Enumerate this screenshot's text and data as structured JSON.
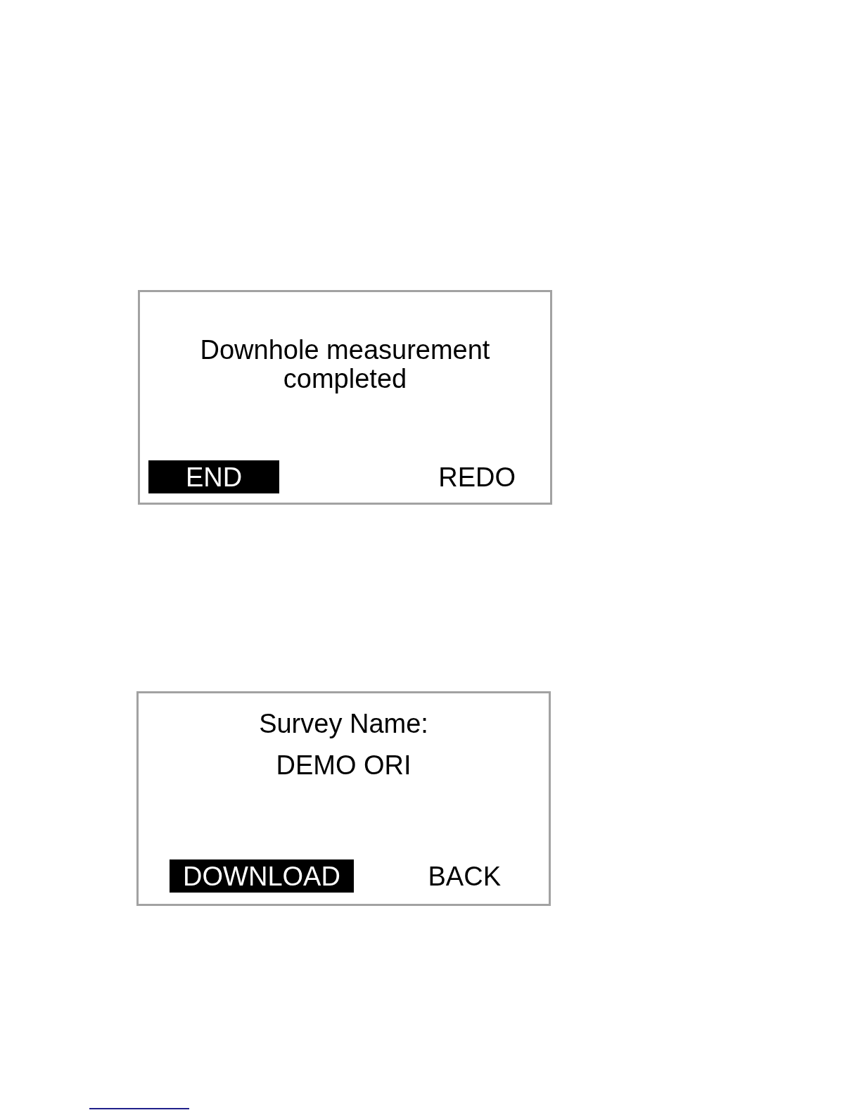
{
  "screens": [
    {
      "kind": "message",
      "message": "Downhole measurement completed",
      "softkeys": [
        {
          "label": "END",
          "selected": true
        },
        {
          "label": "REDO",
          "selected": false
        }
      ]
    },
    {
      "kind": "field",
      "label": "Survey Name:",
      "value": "DEMO ORI",
      "softkeys": [
        {
          "label": "DOWNLOAD",
          "selected": true
        },
        {
          "label": "BACK",
          "selected": false
        }
      ]
    }
  ]
}
